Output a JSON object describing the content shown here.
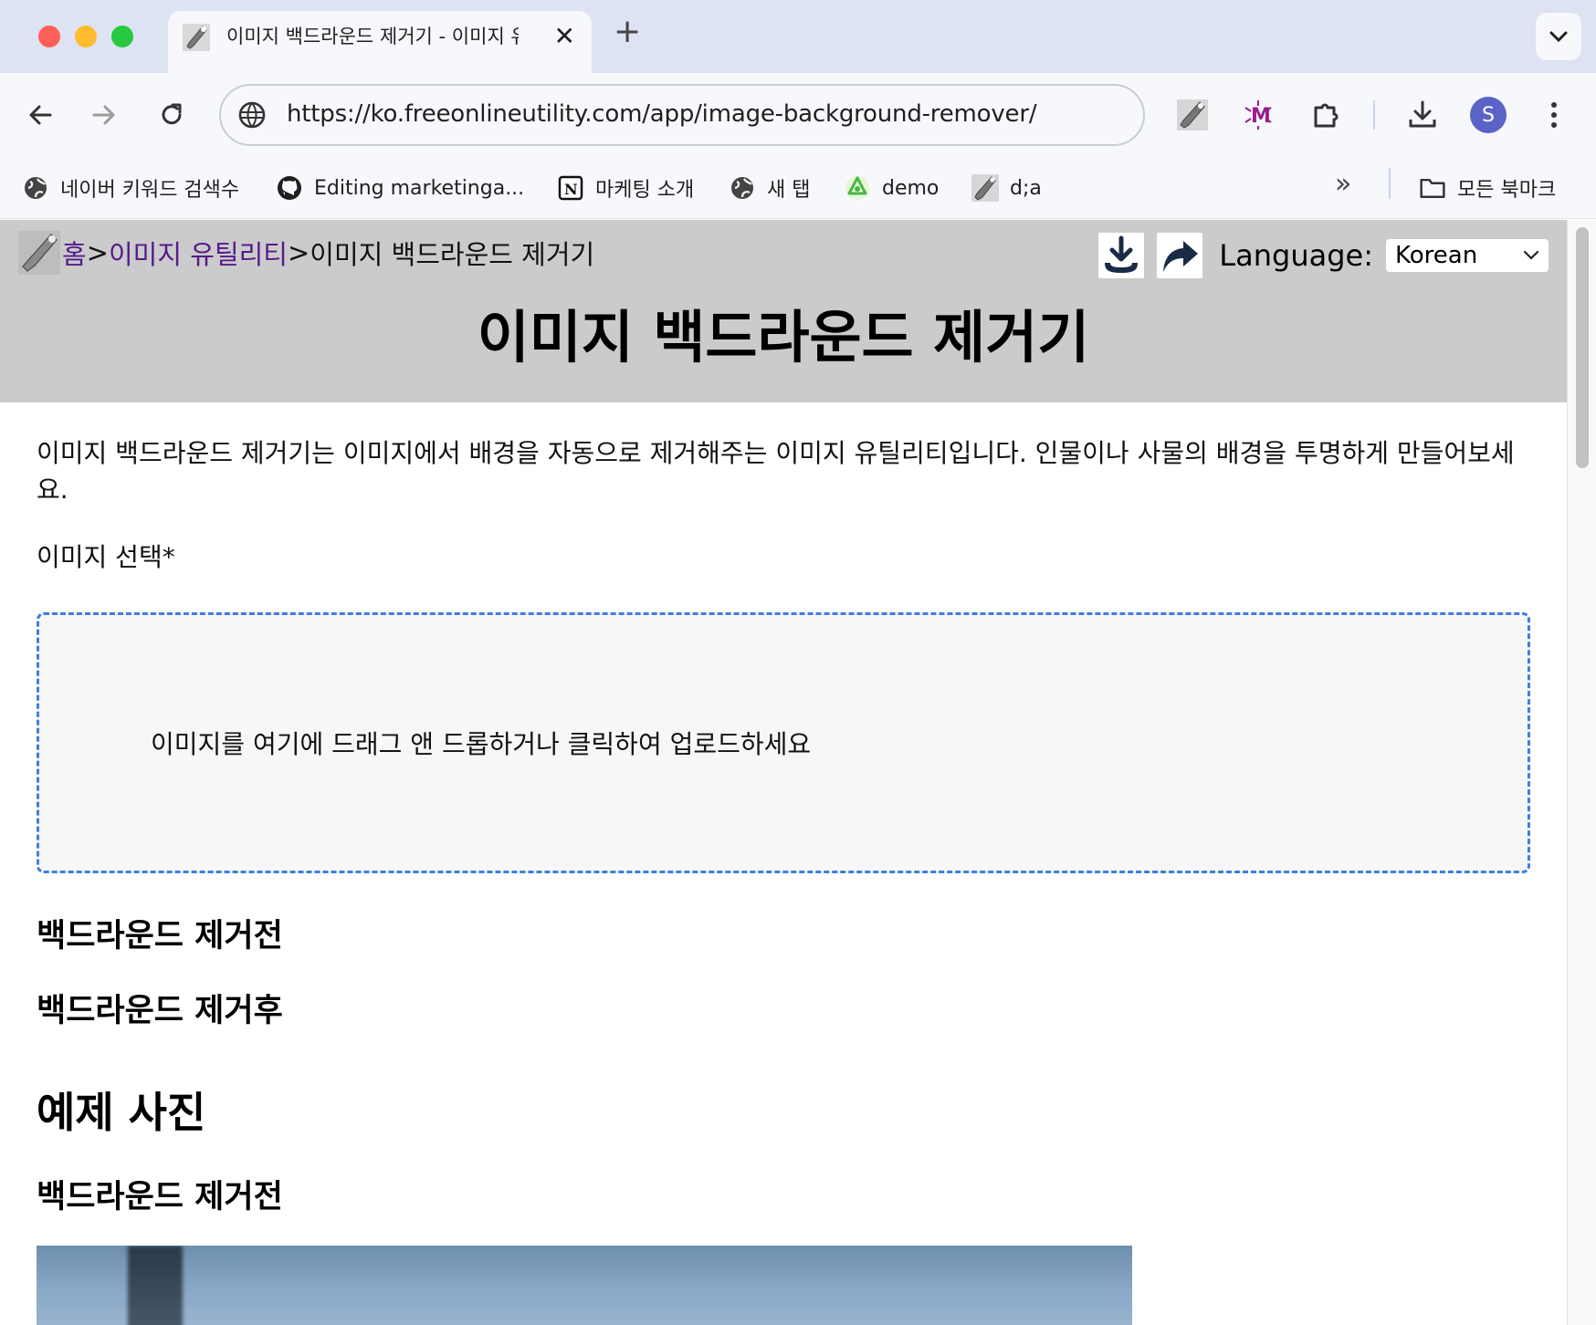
{
  "browser": {
    "tab": {
      "title": "이미지 백드라운드 제거기 - 이미지 유틸리티",
      "close_label": "✕"
    },
    "new_tab_label": "+",
    "address": {
      "url": "https://ko.freeonlineutility.com/app/image-background-remover/"
    },
    "avatar_letter": "S",
    "bookmarks": [
      {
        "label": "네이버 키워드 검색수",
        "icon": "globe-icon"
      },
      {
        "label": "Editing marketinga...",
        "icon": "github-icon"
      },
      {
        "label": "마케팅 소개",
        "icon": "notion-icon"
      },
      {
        "label": "새 탭",
        "icon": "globe-icon"
      },
      {
        "label": "demo",
        "icon": "recycle-icon"
      },
      {
        "label": "d;a",
        "icon": "wrench-icon"
      }
    ],
    "bookmarks_more": "»",
    "all_bookmarks_label": "모든 북마크"
  },
  "page": {
    "breadcrumb": {
      "home": "홈",
      "sep1": ">",
      "category": "이미지 유틸리티",
      "sep2": ">",
      "current": " 이미지 백드라운드 제거기"
    },
    "language_label": "Language:",
    "language_value": "Korean",
    "title": "이미지 백드라운드 제거기",
    "description": "이미지 백드라운드 제거기는 이미지에서 배경을 자동으로 제거해주는 이미지 유틸리티입니다. 인물이나 사물의 배경을 투명하게 만들어보세요.",
    "select_label": "이미지 선택*",
    "dropzone_text": "이미지를 여기에 드래그 앤 드롭하거나 클릭하여 업로드하세요",
    "before_heading": "백드라운드 제거전",
    "after_heading": "백드라운드 제거후",
    "examples_heading": "예제 사진",
    "example_before_heading": "백드라운드 제거전"
  }
}
